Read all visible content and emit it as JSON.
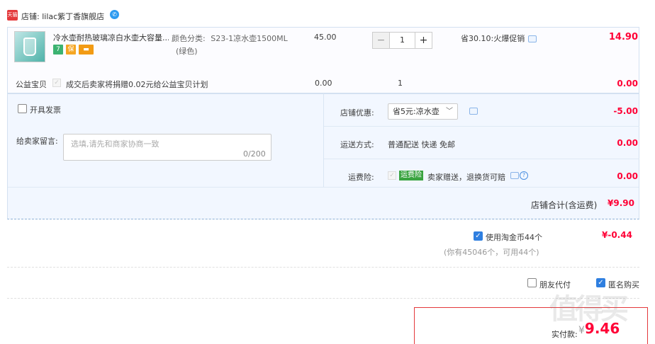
{
  "shop": {
    "label": "店铺: lilac紫丁香旗舰店",
    "badge": "天猫"
  },
  "item": {
    "name": "冷水壶耐热玻璃凉白水壶大容量...",
    "sku_label": "颜色分类:",
    "sku_value": "S23-1凉水壶1500ML",
    "sku_sub": "(绿色)",
    "unit_price": "45.00",
    "quantity": "1",
    "minus": "−",
    "plus": "+",
    "promo": "省30.10:火爆促销",
    "total": "14.90",
    "badges": [
      "7",
      "保",
      "▬"
    ]
  },
  "charity": {
    "label": "公益宝贝",
    "text": "成交后卖家将捐赠0.02元给公益宝贝计划",
    "price": "0.00",
    "qty": "1",
    "total": "0.00"
  },
  "options": {
    "invoice_label": "开具发票",
    "memo_label": "给卖家留言:",
    "memo_placeholder": "选填,请先和商家协商一致",
    "memo_count": "0/200",
    "coupon_label": "店铺优惠:",
    "coupon_value": "省5元:凉水壶",
    "coupon_amount": "-5.00",
    "shipping_label": "运送方式:",
    "shipping_value": "普通配送 快递 免邮",
    "shipping_amount": "0.00",
    "insurance_label": "运费险:",
    "insurance_tag": "运费险",
    "insurance_text": "卖家赠送，退换货可赔",
    "insurance_amount": "0.00",
    "subtotal_label": "店铺合计(含运费)",
    "subtotal_value": "¥9.90"
  },
  "coins": {
    "label": "使用淘金币44个",
    "note": "(你有45046个，可用44个)",
    "value": "¥-0.44"
  },
  "footer": {
    "friend_pay": "朋友代付",
    "anonymous": "匿名购买",
    "pay_label": "实付款:",
    "pay_currency": "¥",
    "pay_amount": "9.46",
    "watermark": "值得买"
  },
  "colors": {
    "accent_red": "#ff0036",
    "panel_blue": "#f2f7ff",
    "check_blue": "#2f7fe0"
  }
}
